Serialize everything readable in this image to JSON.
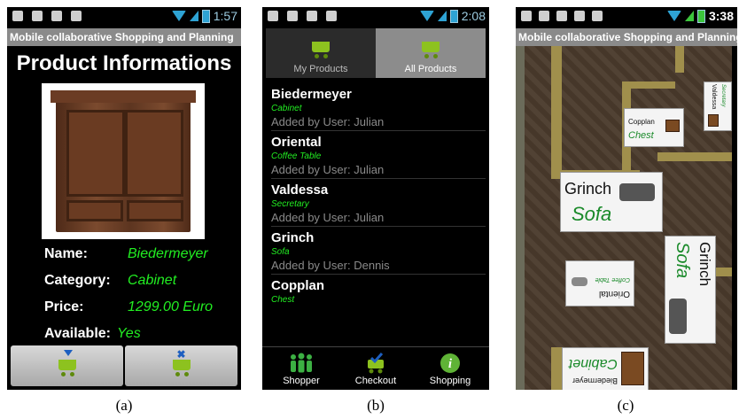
{
  "panel_a": {
    "status_time": "1:57",
    "app_title": "Mobile collaborative Shopping and Planning",
    "heading": "Product Informations",
    "fields": [
      {
        "label": "Name:",
        "value": "Biedermeyer"
      },
      {
        "label": "Category:",
        "value": "Cabinet"
      },
      {
        "label": "Price:",
        "value": "1299.00 Euro"
      },
      {
        "label": "Available:",
        "value": "Yes"
      }
    ],
    "buttons": [
      {
        "icon": "add-to-cart-icon"
      },
      {
        "icon": "remove-from-cart-icon"
      }
    ],
    "caption": "(a)"
  },
  "panel_b": {
    "status_time": "2:08",
    "tabs": [
      {
        "label": "My Products",
        "selected": false
      },
      {
        "label": "All Products",
        "selected": true
      }
    ],
    "products": [
      {
        "name": "Biedermeyer",
        "category": "Cabinet",
        "added_by": "Added by User: Julian"
      },
      {
        "name": "Oriental",
        "category": "Coffee Table",
        "added_by": "Added by User: Julian"
      },
      {
        "name": "Valdessa",
        "category": "Secretary",
        "added_by": "Added by User: Julian"
      },
      {
        "name": "Grinch",
        "category": "Sofa",
        "added_by": "Added by User: Dennis"
      },
      {
        "name": "Copplan",
        "category": "Chest",
        "added_by": ""
      }
    ],
    "bottom_tabs": [
      {
        "label": "Shopper",
        "icon": "people-icon"
      },
      {
        "label": "Checkout",
        "icon": "cart-check-icon"
      },
      {
        "label": "Shopping",
        "icon": "info-icon"
      }
    ],
    "caption": "(b)"
  },
  "panel_c": {
    "status_time": "3:38",
    "app_title": "Mobile collaborative Shopping and Planning",
    "cards": [
      {
        "name": "Valdessa",
        "category": "Secretary"
      },
      {
        "name": "Copplan",
        "category": "Chest"
      },
      {
        "name": "Grinch",
        "category": "Sofa"
      },
      {
        "name": "Oriental",
        "category": "Coffee Table"
      },
      {
        "name": "Grinch",
        "category": "Sofa"
      },
      {
        "name": "Biedermeyer",
        "category": "Cabinet"
      }
    ],
    "caption": "(c)"
  },
  "colors": {
    "accent_green": "#22ee22",
    "status_blue": "#2ea3d4",
    "titlebar_gray": "#8a8a8a"
  }
}
